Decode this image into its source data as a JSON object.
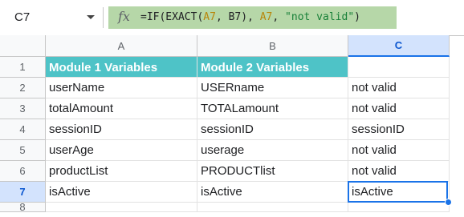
{
  "formula_bar": {
    "name_box": "C7",
    "fx_symbol": "fx",
    "formula_prefix": "=IF(EXACT(",
    "formula_ref1": "A7",
    "formula_mid1": ", B7), ",
    "formula_ref2": "A7",
    "formula_mid2": ", ",
    "formula_str": "\"not valid\"",
    "formula_suffix": ")"
  },
  "columns": [
    "A",
    "B",
    "C"
  ],
  "selected_column": "C",
  "rows": [
    {
      "num": "1",
      "cells": [
        "Module 1 Variables",
        "Module 2 Variables",
        ""
      ]
    },
    {
      "num": "2",
      "cells": [
        "userName",
        "USERname",
        "not valid"
      ]
    },
    {
      "num": "3",
      "cells": [
        "totalAmount",
        "TOTALamount",
        "not valid"
      ]
    },
    {
      "num": "4",
      "cells": [
        "sessionID",
        "sessionID",
        "sessionID"
      ]
    },
    {
      "num": "5",
      "cells": [
        "userAge",
        "userage",
        "not valid"
      ]
    },
    {
      "num": "6",
      "cells": [
        "productList",
        "PRODUCTlist",
        "not valid"
      ]
    },
    {
      "num": "7",
      "cells": [
        "isActive",
        "isActive",
        "isActive"
      ]
    },
    {
      "num": "8",
      "cells": [
        "",
        "",
        ""
      ]
    }
  ],
  "selected_row": "7",
  "colors": {
    "header_fill": "#4ec3c7",
    "formula_highlight": "#b6d7a8",
    "selection": "#1a73e8"
  }
}
